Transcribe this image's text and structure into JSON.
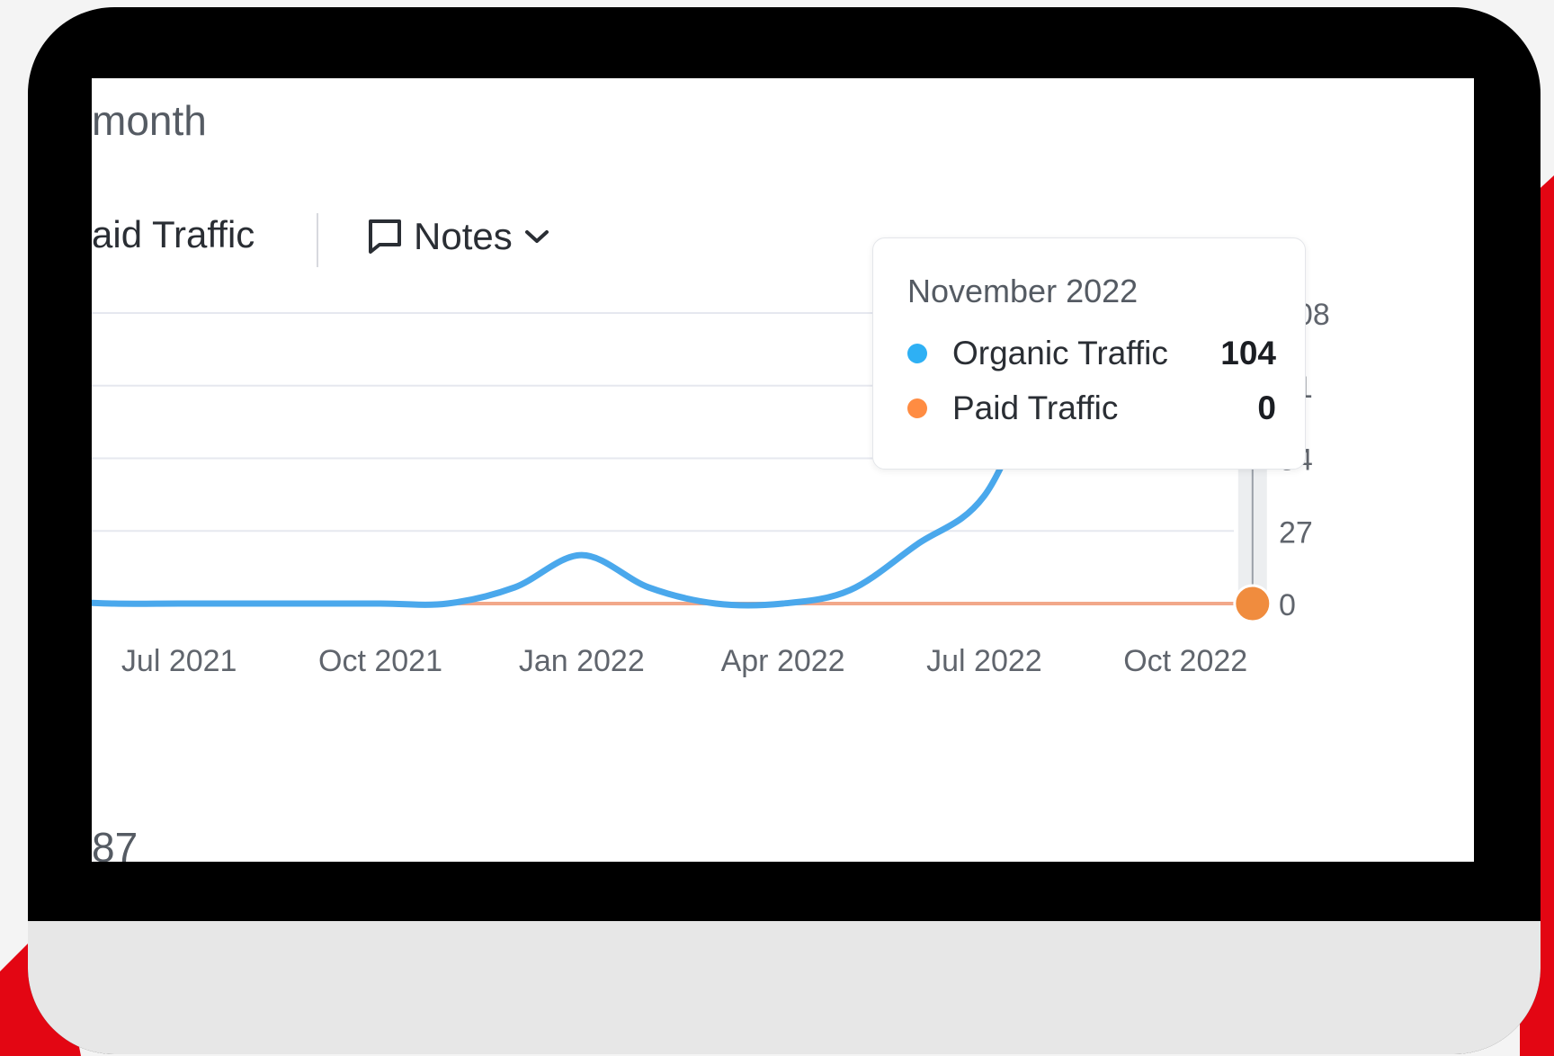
{
  "header": {
    "subtitle": "month"
  },
  "toolbar": {
    "paid_label": "aid Traffic",
    "notes_label": "Notes"
  },
  "tooltip": {
    "title": "November 2022",
    "rows": [
      {
        "name": "Organic Traffic",
        "value": "104",
        "color": "#2eb0f4"
      },
      {
        "name": "Paid Traffic",
        "value": "0",
        "color": "#ff8c42"
      }
    ]
  },
  "footer": {
    "value": "87"
  },
  "colors": {
    "organic_line": "#4aa8ec",
    "paid_line": "#f2a88a",
    "marker_organic": "#4aa8ec",
    "marker_paid": "#f08c3e",
    "accent_red": "#e30613",
    "grid": "#e6e8ef"
  },
  "chart_data": {
    "type": "line",
    "x_ticks": [
      "Jul 2021",
      "Oct 2021",
      "Jan 2022",
      "Apr 2022",
      "Jul 2022",
      "Oct 2022"
    ],
    "y_ticks": [
      "0",
      "27",
      "54",
      "81",
      "108"
    ],
    "ylim": [
      0,
      108
    ],
    "grid": true,
    "y_axis_position": "right",
    "x": [
      "May 2021",
      "Jun 2021",
      "Jul 2021",
      "Aug 2021",
      "Sep 2021",
      "Oct 2021",
      "Nov 2021",
      "Dec 2021",
      "Jan 2022",
      "Feb 2022",
      "Mar 2022",
      "Apr 2022",
      "May 2022",
      "Jun 2022",
      "Jul 2022",
      "Aug 2022",
      "Sep 2022",
      "Oct 2022",
      "Nov 2022"
    ],
    "series": [
      {
        "name": "Organic Traffic",
        "values": [
          1,
          0,
          0,
          0,
          0,
          0,
          0,
          6,
          18,
          6,
          0,
          0,
          5,
          22,
          40,
          88,
          98,
          100,
          104
        ]
      },
      {
        "name": "Paid Traffic",
        "values": [
          0,
          0,
          0,
          0,
          0,
          0,
          0,
          0,
          0,
          0,
          0,
          0,
          0,
          0,
          0,
          0,
          0,
          0,
          0
        ]
      }
    ]
  }
}
